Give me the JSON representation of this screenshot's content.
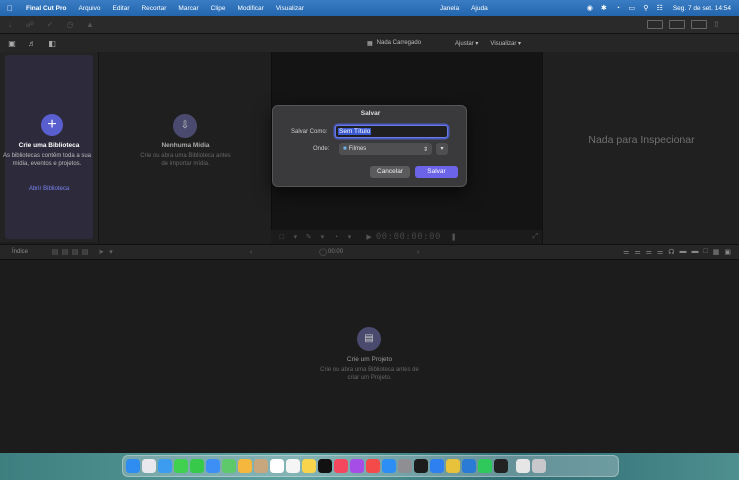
{
  "menubar": {
    "app_name": "Final Cut Pro",
    "items": [
      "Arquivo",
      "Editar",
      "Recortar",
      "Marcar",
      "Clipe",
      "Modificar",
      "Visualizar"
    ],
    "right_items": [
      "Janela",
      "Ajuda"
    ],
    "clock": "Seg. 7 de set.  14:54"
  },
  "viewer_header": {
    "title": "Nada Carregado",
    "adjust": "Ajustar",
    "view": "Visualizar"
  },
  "sidebar": {
    "title": "Crie uma Biblioteca",
    "description": "As bibliotecas contêm toda a sua mídia, eventos e projetos.",
    "link": "Abrir Biblioteca"
  },
  "browser": {
    "title": "Nenhuma Mídia",
    "description": "Crie ou abra uma Biblioteca antes de importar mídia."
  },
  "viewer": {
    "timecode": "00:00:00:00"
  },
  "inspector": {
    "empty_text": "Nada para Inspecionar"
  },
  "timeline_header": {
    "index": "Índice",
    "timecode": "00:00"
  },
  "timeline": {
    "title": "Crie um Projeto",
    "description": "Crie ou abra uma Biblioteca antes de criar um Projeto."
  },
  "save_dialog": {
    "title": "Salvar",
    "save_as_label": "Salvar Como:",
    "save_as_value": "Sem Título",
    "where_label": "Onde:",
    "where_value": "Filmes",
    "cancel_label": "Cancelar",
    "save_label": "Salvar"
  },
  "dock_apps": [
    {
      "name": "finder",
      "color": "#2f8cf0"
    },
    {
      "name": "launchpad",
      "color": "#e8e8ee"
    },
    {
      "name": "safari",
      "color": "#3b9cf0"
    },
    {
      "name": "messages",
      "color": "#3fd14f"
    },
    {
      "name": "facetime",
      "color": "#36c94a"
    },
    {
      "name": "mail",
      "color": "#3d8ff5"
    },
    {
      "name": "maps",
      "color": "#5ec96a"
    },
    {
      "name": "photos",
      "color": "#f5b73d"
    },
    {
      "name": "contacts",
      "color": "#c9a77e"
    },
    {
      "name": "calendar",
      "color": "#ffffff"
    },
    {
      "name": "reminders",
      "color": "#f5f5f5"
    },
    {
      "name": "notes",
      "color": "#f8d44c"
    },
    {
      "name": "tv",
      "color": "#111111"
    },
    {
      "name": "music",
      "color": "#f5475e"
    },
    {
      "name": "podcasts",
      "color": "#a54de6"
    },
    {
      "name": "news",
      "color": "#f54a4a"
    },
    {
      "name": "app-store",
      "color": "#2d8ef5"
    },
    {
      "name": "system-preferences",
      "color": "#8e8e93"
    },
    {
      "name": "terminal",
      "color": "#1c1c1c"
    },
    {
      "name": "xcode",
      "color": "#2e7ff0"
    },
    {
      "name": "chrome",
      "color": "#e9c23c"
    },
    {
      "name": "vscode",
      "color": "#2a7bd6"
    },
    {
      "name": "whatsapp",
      "color": "#2fc85a"
    },
    {
      "name": "final-cut-pro",
      "color": "#222222"
    },
    {
      "name": "document",
      "color": "#e6e6e6"
    },
    {
      "name": "trash",
      "color": "#c8c8cc"
    }
  ],
  "colors": {
    "accent": "#6b64e8",
    "menubar": "#2a6fb8"
  }
}
